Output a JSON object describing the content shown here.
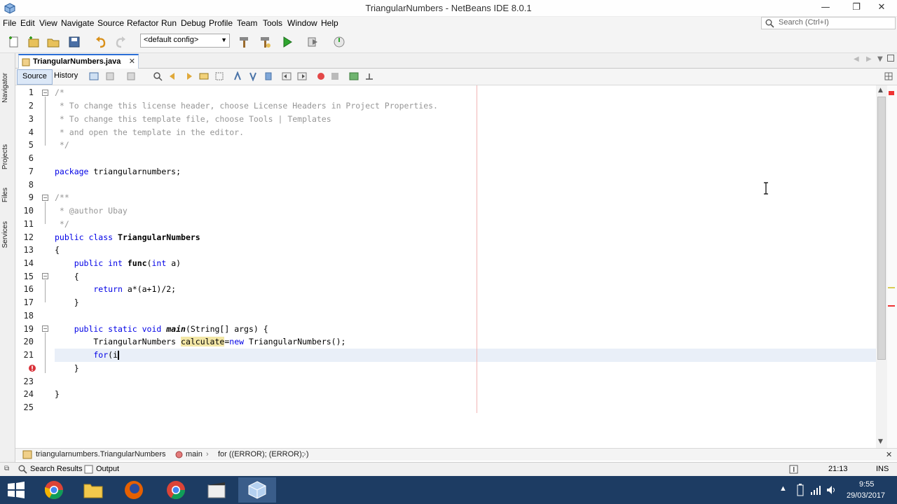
{
  "window": {
    "title": "TriangularNumbers - NetBeans IDE 8.0.1",
    "minimize": "—",
    "maximize": "❐",
    "close": "✕"
  },
  "menu": [
    "File",
    "Edit",
    "View",
    "Navigate",
    "Source",
    "Refactor",
    "Run",
    "Debug",
    "Profile",
    "Team",
    "Tools",
    "Window",
    "Help"
  ],
  "search": {
    "placeholder": "Search (Ctrl+I)"
  },
  "toolbar": {
    "config_value": "<default config>"
  },
  "side_tabs": [
    "Navigator",
    "Projects",
    "Files",
    "Services"
  ],
  "editor": {
    "file_tab": "TriangularNumbers.java",
    "tab_close": "✕",
    "view_tabs": [
      "Source",
      "History"
    ],
    "line_numbers": [
      "1",
      "2",
      "3",
      "4",
      "5",
      "6",
      "7",
      "8",
      "9",
      "10",
      "11",
      "12",
      "13",
      "14",
      "15",
      "16",
      "17",
      "18",
      "19",
      "20",
      "21",
      "22",
      "23",
      "24",
      "25"
    ],
    "lines": {
      "l1": "/*",
      "l2": " * To change this license header, choose License Headers in Project Properties.",
      "l3": " * To change this template file, choose Tools | Templates",
      "l4": " * and open the template in the editor.",
      "l5": " */",
      "l7_kw": "package",
      "l7_rest": " triangularnumbers;",
      "l9": "/**",
      "l10": " * @author Ubay",
      "l11": " */",
      "l12_kw": "public class",
      "l12_name": " TriangularNumbers",
      "l13": "{",
      "l14_kw1": "    public int",
      "l14_fn": " func",
      "l14_p": "(",
      "l14_kw2": "int",
      "l14_rest": " a)",
      "l15": "    {",
      "l16_kw": "        return",
      "l16_rest": " a*(a+1)/2;",
      "l17": "    }",
      "l19_kw": "    public static void",
      "l19_fn": " main",
      "l19_rest": "(String[] args) {",
      "l20_a": "        TriangularNumbers ",
      "l20_var": "calculate",
      "l20_b": "=",
      "l20_kw": "new",
      "l20_c": " TriangularNumbers();",
      "l21_kw": "        for",
      "l21_rest": "(i",
      "l22": "    }",
      "l24": "}"
    }
  },
  "breadcrumb": [
    "triangularnumbers.TriangularNumbers",
    "main",
    "for ((ERROR); (ERROR); )"
  ],
  "status": {
    "search_results": "Search Results",
    "output": "Output",
    "position": "21:13",
    "mode": "INS"
  },
  "taskbar": {
    "time": "9:55",
    "date": "29/03/2017"
  },
  "colors": {
    "keyword": "#0000e6",
    "comment": "#969696",
    "taskbar": "#1d3c63",
    "tab_accent": "#2b6fd6"
  }
}
